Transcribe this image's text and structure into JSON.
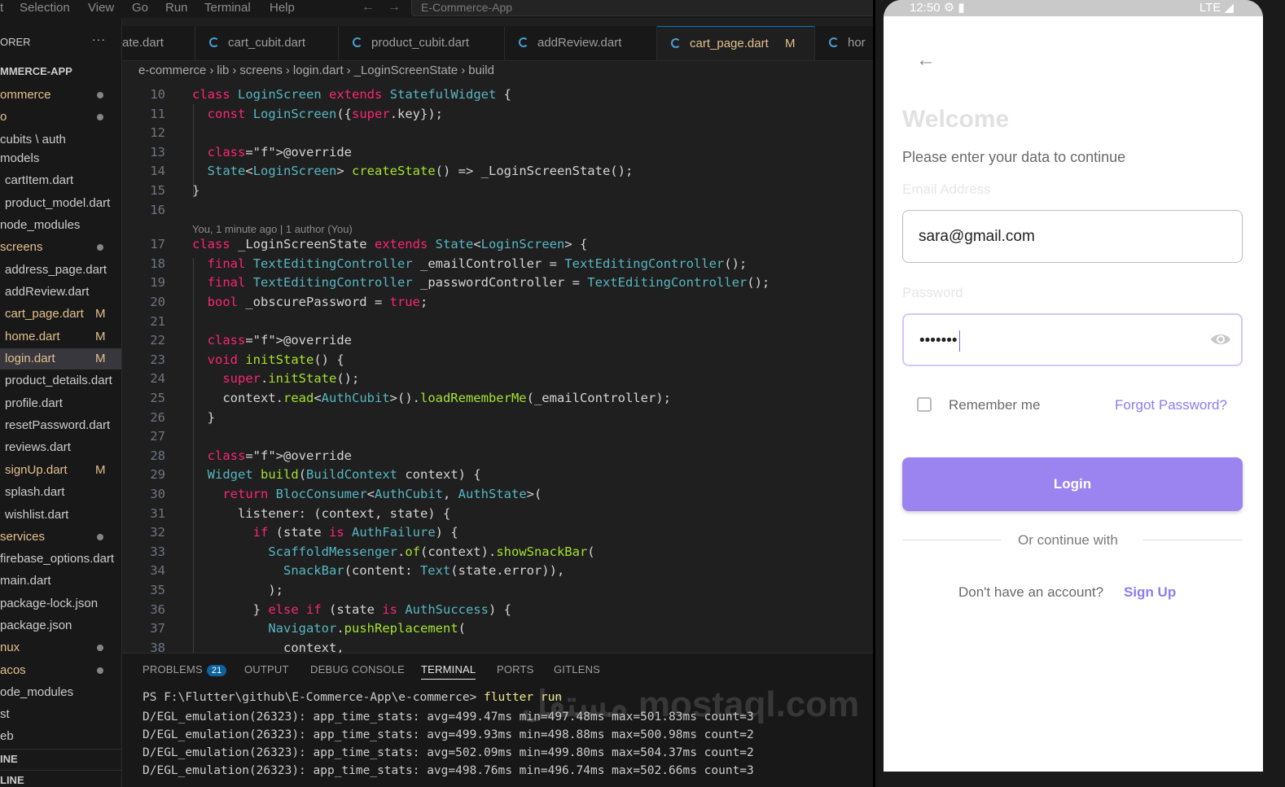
{
  "menubar": {
    "items": [
      "t",
      "Selection",
      "View",
      "Go",
      "Run",
      "Terminal",
      "Help"
    ],
    "search": "E-Commerce-App"
  },
  "explorer": {
    "header": "ORER",
    "root": "MMERCE-APP",
    "tree": [
      {
        "label": "ommerce",
        "indent": 0,
        "status": "dot",
        "color": "#e2c08d"
      },
      {
        "label": "o",
        "indent": 0,
        "status": "dot",
        "color": "#e2c08d"
      },
      {
        "label": "cubits \\ auth",
        "indent": 0,
        "status": "",
        "color": "#cccccc"
      },
      {
        "label": "models",
        "indent": 0,
        "status": "",
        "color": "#cccccc"
      },
      {
        "label": "cartItem.dart",
        "indent": 1,
        "status": "",
        "color": "#cccccc"
      },
      {
        "label": "product_model.dart",
        "indent": 1,
        "status": "",
        "color": "#cccccc"
      },
      {
        "label": "node_modules",
        "indent": 0,
        "status": "",
        "color": "#cccccc"
      },
      {
        "label": "screens",
        "indent": 0,
        "status": "dot",
        "color": "#e2c08d"
      },
      {
        "label": "address_page.dart",
        "indent": 1,
        "status": "",
        "color": "#cccccc"
      },
      {
        "label": "addReview.dart",
        "indent": 1,
        "status": "",
        "color": "#cccccc"
      },
      {
        "label": "cart_page.dart",
        "indent": 1,
        "status": "M",
        "color": "#e2c08d"
      },
      {
        "label": "home.dart",
        "indent": 1,
        "status": "M",
        "color": "#e2c08d"
      },
      {
        "label": "login.dart",
        "indent": 1,
        "status": "M",
        "color": "#e2c08d"
      },
      {
        "label": "product_details.dart",
        "indent": 1,
        "status": "",
        "color": "#cccccc"
      },
      {
        "label": "profile.dart",
        "indent": 1,
        "status": "",
        "color": "#cccccc"
      },
      {
        "label": "resetPassword.dart",
        "indent": 1,
        "status": "",
        "color": "#cccccc"
      },
      {
        "label": "reviews.dart",
        "indent": 1,
        "status": "",
        "color": "#cccccc"
      },
      {
        "label": "signUp.dart",
        "indent": 1,
        "status": "M",
        "color": "#e2c08d"
      },
      {
        "label": "splash.dart",
        "indent": 1,
        "status": "",
        "color": "#cccccc"
      },
      {
        "label": "wishlist.dart",
        "indent": 1,
        "status": "",
        "color": "#cccccc"
      },
      {
        "label": "services",
        "indent": 0,
        "status": "dot",
        "color": "#e2c08d"
      },
      {
        "label": "firebase_options.dart",
        "indent": 0,
        "status": "",
        "color": "#cccccc"
      },
      {
        "label": "main.dart",
        "indent": 0,
        "status": "",
        "color": "#cccccc"
      },
      {
        "label": "package-lock.json",
        "indent": 0,
        "status": "",
        "color": "#cccccc"
      },
      {
        "label": "package.json",
        "indent": 0,
        "status": "",
        "color": "#cccccc"
      },
      {
        "label": "nux",
        "indent": 0,
        "status": "dot",
        "color": "#e2c08d"
      },
      {
        "label": "acos",
        "indent": 0,
        "status": "dot",
        "color": "#e2c08d"
      },
      {
        "label": "ode_modules",
        "indent": 0,
        "status": "",
        "color": "#cccccc"
      },
      {
        "label": "st",
        "indent": 0,
        "status": "",
        "color": "#cccccc"
      },
      {
        "label": "eb",
        "indent": 0,
        "status": "",
        "color": "#cccccc"
      }
    ],
    "active_index": 12,
    "sections": [
      "INE",
      "LINE"
    ]
  },
  "tabs": [
    {
      "label": "ate.dart",
      "mod": "",
      "active": false,
      "icon": false
    },
    {
      "label": "cart_cubit.dart",
      "mod": "",
      "active": false,
      "icon": true
    },
    {
      "label": "product_cubit.dart",
      "mod": "",
      "active": false,
      "icon": true
    },
    {
      "label": "addReview.dart",
      "mod": "",
      "active": false,
      "icon": true
    },
    {
      "label": "cart_page.dart",
      "mod": "M",
      "active": true,
      "icon": true
    },
    {
      "label": "hor",
      "mod": "",
      "active": false,
      "icon": true
    }
  ],
  "breadcrumb": [
    "e-commerce",
    "lib",
    "screens",
    "login.dart",
    "_LoginScreenState",
    "build"
  ],
  "blame": "You, 1 minute ago | 1 author (You)",
  "code": [
    {
      "n": "10",
      "t": "class LoginScreen extends StatefulWidget {"
    },
    {
      "n": "11",
      "t": "  const LoginScreen({super.key});"
    },
    {
      "n": "12",
      "t": ""
    },
    {
      "n": "13",
      "t": "  @override"
    },
    {
      "n": "14",
      "t": "  State<LoginScreen> createState() => _LoginScreenState();"
    },
    {
      "n": "15",
      "t": "}"
    },
    {
      "n": "16",
      "t": ""
    },
    {
      "n": "17",
      "t": "class _LoginScreenState extends State<LoginScreen> {"
    },
    {
      "n": "18",
      "t": "  final TextEditingController _emailController = TextEditingController();"
    },
    {
      "n": "19",
      "t": "  final TextEditingController _passwordController = TextEditingController();"
    },
    {
      "n": "20",
      "t": "  bool _obscurePassword = true;"
    },
    {
      "n": "21",
      "t": ""
    },
    {
      "n": "22",
      "t": "  @override"
    },
    {
      "n": "23",
      "t": "  void initState() {"
    },
    {
      "n": "24",
      "t": "    super.initState();"
    },
    {
      "n": "25",
      "t": "    context.read<AuthCubit>().loadRememberMe(_emailController);"
    },
    {
      "n": "26",
      "t": "  }"
    },
    {
      "n": "27",
      "t": ""
    },
    {
      "n": "28",
      "t": "  @override"
    },
    {
      "n": "29",
      "t": "  Widget build(BuildContext context) {"
    },
    {
      "n": "30",
      "t": "    return BlocConsumer<AuthCubit, AuthState>("
    },
    {
      "n": "31",
      "t": "      listener: (context, state) {"
    },
    {
      "n": "32",
      "t": "        if (state is AuthFailure) {"
    },
    {
      "n": "33",
      "t": "          ScaffoldMessenger.of(context).showSnackBar("
    },
    {
      "n": "34",
      "t": "            SnackBar(content: Text(state.error)),"
    },
    {
      "n": "35",
      "t": "          );"
    },
    {
      "n": "36",
      "t": "        } else if (state is AuthSuccess) {"
    },
    {
      "n": "37",
      "t": "          Navigator.pushReplacement("
    },
    {
      "n": "38",
      "t": "            context,"
    }
  ],
  "panel": {
    "tabs": [
      "PROBLEMS",
      "OUTPUT",
      "DEBUG CONSOLE",
      "TERMINAL",
      "PORTS",
      "GITLENS"
    ],
    "problems_count": "21",
    "active_tab": "TERMINAL",
    "prompt": "PS F:\\Flutter\\github\\E-Commerce-App\\e-commerce> ",
    "command": "flutter run",
    "lines": [
      "D/EGL_emulation(26323): app_time_stats: avg=499.47ms min=497.48ms max=501.83ms count=3",
      "D/EGL_emulation(26323): app_time_stats: avg=499.93ms min=498.88ms max=500.98ms count=2",
      "D/EGL_emulation(26323): app_time_stats: avg=502.09ms min=499.80ms max=504.37ms count=2",
      "D/EGL_emulation(26323): app_time_stats: avg=498.76ms min=496.74ms max=502.66ms count=3"
    ]
  },
  "watermark": "مستقل mostaql.com",
  "phone": {
    "time": "12:50",
    "network": "LTE",
    "title": "Welcome",
    "subtitle": "Please enter your data to continue",
    "email_label": "Email Address",
    "email_value": "sara@gmail.com",
    "password_label": "Password",
    "password_value": "•••••••",
    "remember": "Remember me",
    "remember_checked": false,
    "forgot": "Forgot Password?",
    "login": "Login",
    "or": "Or continue with",
    "no_account": "Don't have an account?",
    "signup": "Sign Up",
    "accent": "#9b84f0"
  }
}
